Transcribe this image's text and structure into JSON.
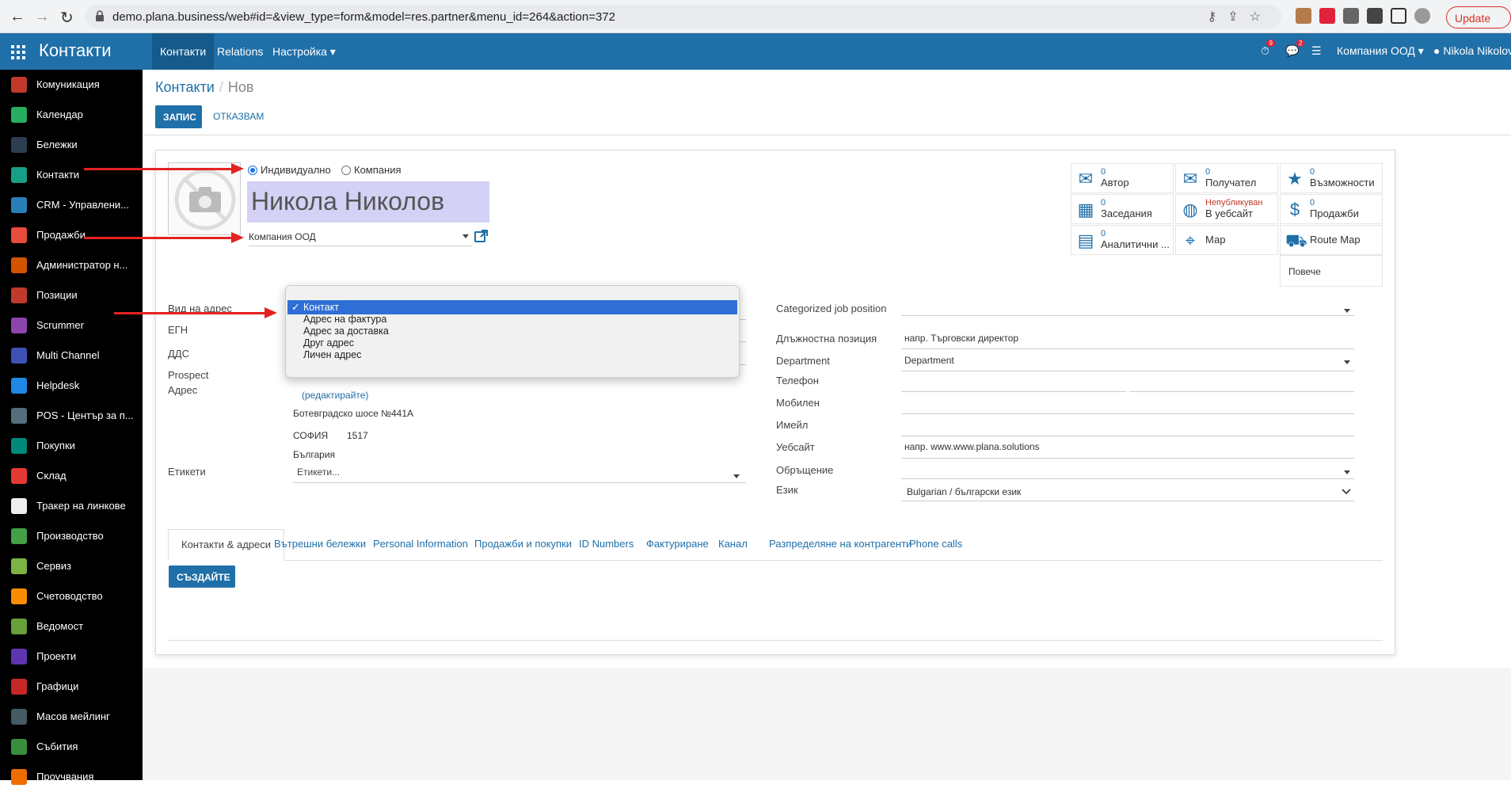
{
  "browser": {
    "url": "demo.plana.business/web#id=&view_type=form&model=res.partner&menu_id=264&action=372",
    "update_label": "Update"
  },
  "topbar": {
    "brand": "Контакти",
    "menu": [
      "Контакти",
      "Relations",
      "Настройка"
    ],
    "company": "Компания ООД",
    "user": "Nikola Nikolov",
    "activity_count": "9",
    "message_count": "2"
  },
  "sidebar": {
    "items": [
      {
        "label": "Комуникация",
        "color": "#c0392b"
      },
      {
        "label": "Календар",
        "color": "#27ae60"
      },
      {
        "label": "Бележки",
        "color": "#2c3e50"
      },
      {
        "label": "Контакти",
        "color": "#16a085"
      },
      {
        "label": "CRM - Управлени...",
        "color": "#2980b9"
      },
      {
        "label": "Продажби",
        "color": "#e74c3c"
      },
      {
        "label": "Администратор н...",
        "color": "#d35400"
      },
      {
        "label": "Позиции",
        "color": "#c0392b"
      },
      {
        "label": "Scrummer",
        "color": "#8e44ad"
      },
      {
        "label": "Multi Channel",
        "color": "#3f51b5"
      },
      {
        "label": "Helpdesk",
        "color": "#1e88e5"
      },
      {
        "label": "POS - Център за п...",
        "color": "#546e7a"
      },
      {
        "label": "Покупки",
        "color": "#00897b"
      },
      {
        "label": "Склад",
        "color": "#e53935"
      },
      {
        "label": "Тракер на линкове",
        "color": "#eeeeee"
      },
      {
        "label": "Производство",
        "color": "#43a047"
      },
      {
        "label": "Сервиз",
        "color": "#7cb342"
      },
      {
        "label": "Счетоводство",
        "color": "#fb8c00"
      },
      {
        "label": "Ведомост",
        "color": "#689f38"
      },
      {
        "label": "Проекти",
        "color": "#5e35b1"
      },
      {
        "label": "Графици",
        "color": "#c62828"
      },
      {
        "label": "Масов мейлинг",
        "color": "#455a64"
      },
      {
        "label": "Събития",
        "color": "#388e3c"
      },
      {
        "label": "Проучвания",
        "color": "#ef6c00"
      }
    ]
  },
  "breadcrumb": {
    "parent": "Контакти",
    "separator": "/",
    "current": "Нов"
  },
  "actions": {
    "save": "ЗАПИС",
    "discard": "ОТКАЗВАМ"
  },
  "form": {
    "type_individual": "Индивидуално",
    "type_company": "Компания",
    "name": "Никола Николов",
    "company": "Компания ООД",
    "labels": {
      "address_type": "Вид на адрес",
      "egn": "ЕГН",
      "vat": "ДДС",
      "prospect": "Prospect",
      "address": "Адрес",
      "tags": "Етикети"
    },
    "address": {
      "edit_link": "(редактирайте)",
      "street": "Ботевградско шосе №441А",
      "city": "СОФИЯ",
      "zip": "1517",
      "country": "България"
    },
    "tags_placeholder": "Етикети...",
    "right": {
      "job_category_label": "Categorized job position",
      "job_label": "Длъжностна позиция",
      "job_placeholder": "напр. Търговски директор",
      "department_label": "Department",
      "department_value": "Department",
      "phone_label": "Телефон",
      "mobile_label": "Мобилен",
      "email_label": "Имейл",
      "website_label": "Уебсайт",
      "website_placeholder": "напр. www.www.plana.solutions",
      "title_label": "Обръщение",
      "lang_label": "Език",
      "lang_value": "Bulgarian / български език"
    }
  },
  "smart_buttons": [
    {
      "count": "0",
      "label": "Автор",
      "icon": "envelope"
    },
    {
      "count": "0",
      "label": "Получател",
      "icon": "envelope"
    },
    {
      "count": "0",
      "label": "Възможности",
      "icon": "star"
    },
    {
      "count": "0",
      "label": "Заседания",
      "icon": "calendar"
    },
    {
      "count": "Непубликуван",
      "label": "В уебсайт",
      "icon": "globe"
    },
    {
      "count": "0",
      "label": "Продажби",
      "icon": "dollar"
    },
    {
      "count": "0",
      "label": "Аналитични ...",
      "icon": "book"
    },
    {
      "count": "",
      "label": "Мар",
      "icon": "map-marker"
    },
    {
      "count": "",
      "label": "Route Map",
      "icon": "car"
    }
  ],
  "more_label": "Повече",
  "address_dropdown": {
    "options": [
      "Контакт",
      "Адрес на фактура",
      "Адрес за доставка",
      "Друг адрес",
      "Личен адрес"
    ],
    "selected": "Контакт",
    "check": "✓"
  },
  "tabs": [
    "Контакти & адреси",
    "Вътрешни бележки",
    "Personal Information",
    "Продажби и покупки",
    "ID Numbers",
    "Фактуриране",
    "Канал",
    "Разпределяне на контрагенти",
    "Phone calls"
  ],
  "create_label": "СЪЗДАЙТЕ",
  "colors": {
    "brand": "#1f6fa8",
    "highlight": "#d3d1f5",
    "annotation": "#e52222",
    "selected_option": "#2f6fd5"
  }
}
